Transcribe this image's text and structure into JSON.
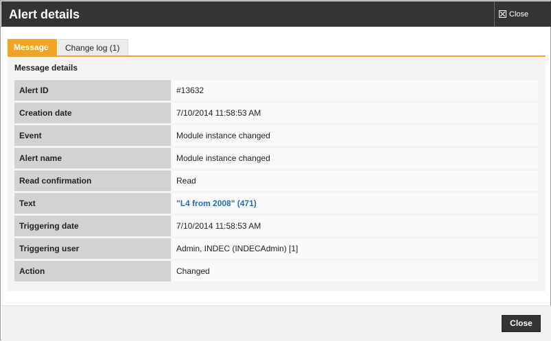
{
  "window": {
    "title": "Alert details",
    "close_label": "Close"
  },
  "tabs": [
    {
      "label": "Message",
      "active": true
    },
    {
      "label": "Change log (1)",
      "active": false
    }
  ],
  "section_title": "Message details",
  "details": [
    {
      "label": "Alert ID",
      "value": "#13632"
    },
    {
      "label": "Creation date",
      "value": "7/10/2014 11:58:53 AM"
    },
    {
      "label": "Event",
      "value": "Module instance changed"
    },
    {
      "label": "Alert name",
      "value": "Module instance changed"
    },
    {
      "label": "Read confirmation",
      "value": "Read"
    },
    {
      "label": "Text",
      "value": "\"L4 from 2008\" (471)"
    },
    {
      "label": "Triggering date",
      "value": "7/10/2014 11:58:53 AM"
    },
    {
      "label": "Triggering user",
      "value": "Admin, INDEC (INDECAdmin) [1]"
    },
    {
      "label": "Action",
      "value": "Changed"
    }
  ],
  "footer": {
    "close_button": "Close"
  },
  "colors": {
    "titlebar": "#343434",
    "accent_tab": "#f0a421",
    "link": "#1f6fb3"
  },
  "icons": {
    "close": "close-x-box-icon"
  }
}
